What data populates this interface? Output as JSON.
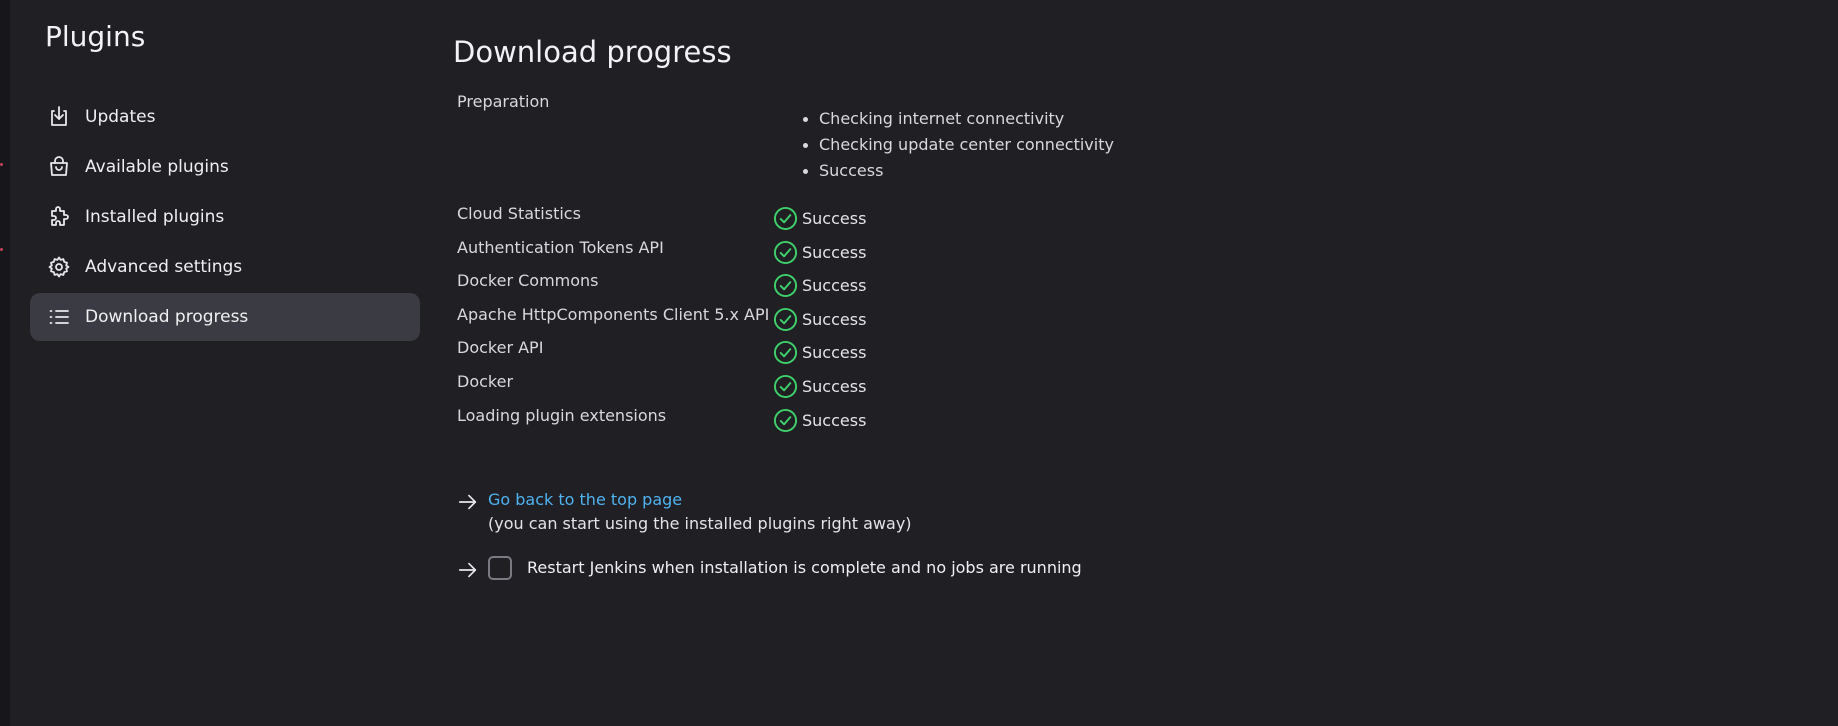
{
  "sidebar": {
    "title": "Plugins",
    "items": [
      {
        "label": "Updates",
        "icon": "download-icon",
        "active": false
      },
      {
        "label": "Available plugins",
        "icon": "shopping-bag-icon",
        "active": false
      },
      {
        "label": "Installed plugins",
        "icon": "puzzle-icon",
        "active": false
      },
      {
        "label": "Advanced settings",
        "icon": "gear-icon",
        "active": false
      },
      {
        "label": "Download progress",
        "icon": "list-icon",
        "active": true
      }
    ]
  },
  "main": {
    "title": "Download progress",
    "preparation": {
      "label": "Preparation",
      "steps": [
        "Checking internet connectivity",
        "Checking update center connectivity",
        "Success"
      ]
    },
    "plugins": [
      {
        "name": "Cloud Statistics",
        "status": "Success"
      },
      {
        "name": "Authentication Tokens API",
        "status": "Success"
      },
      {
        "name": "Docker Commons",
        "status": "Success"
      },
      {
        "name": "Apache HttpComponents Client 5.x API",
        "status": "Success"
      },
      {
        "name": "Docker API",
        "status": "Success"
      },
      {
        "name": "Docker",
        "status": "Success"
      },
      {
        "name": "Loading plugin extensions",
        "status": "Success"
      }
    ],
    "back_link": {
      "label": "Go back to the top page",
      "note": "(you can start using the installed plugins right away)"
    },
    "restart": {
      "label": "Restart Jenkins when installation is complete and no jobs are running",
      "checked": false
    }
  },
  "colors": {
    "background": "#1f1f24",
    "active_item": "#3b3b44",
    "success": "#3fd16b",
    "link": "#4fb3f0"
  }
}
